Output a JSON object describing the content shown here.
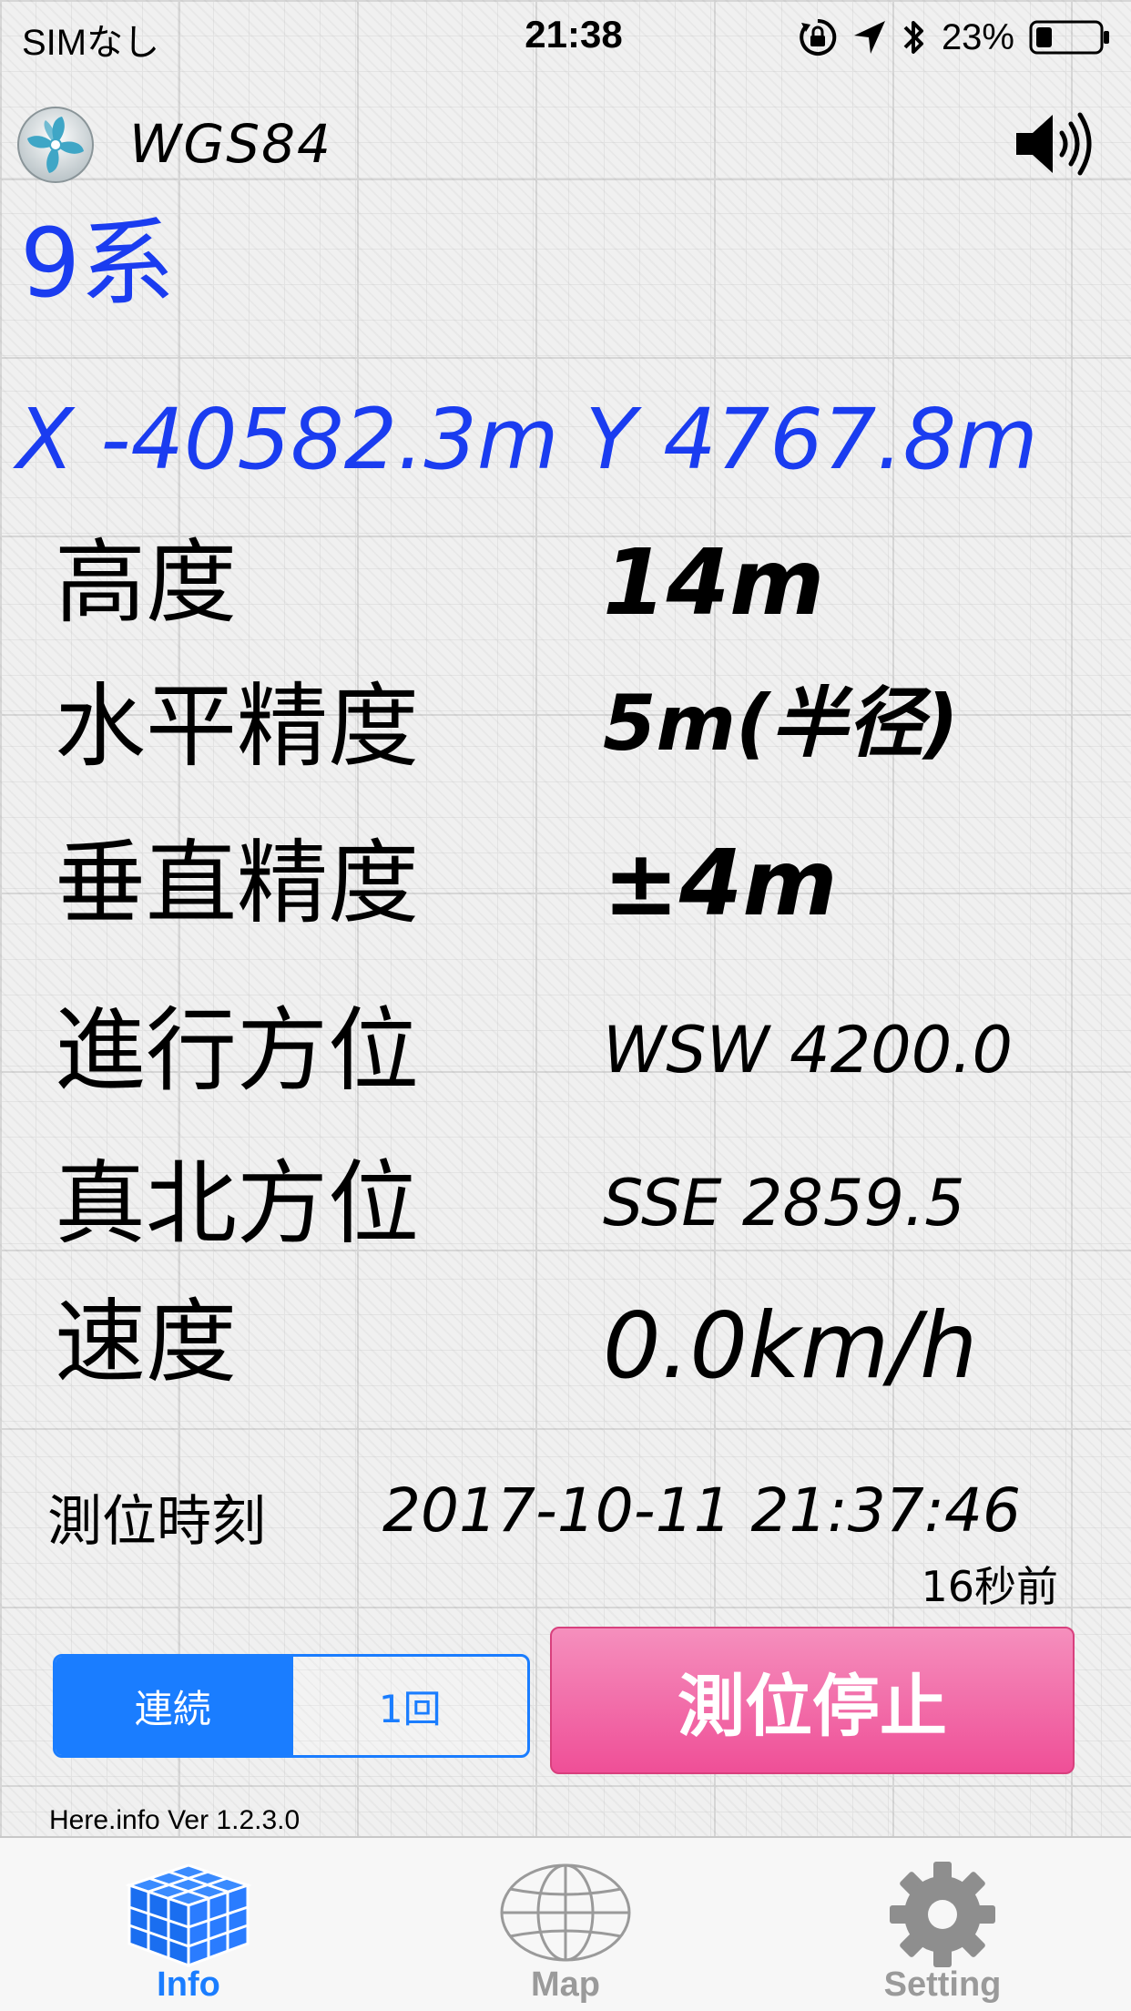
{
  "status_bar": {
    "carrier": "SIMなし",
    "time": "21:38",
    "battery": "23%",
    "icons": [
      "rotation-lock-icon",
      "location-arrow-icon",
      "bluetooth-icon",
      "battery-icon"
    ]
  },
  "header": {
    "logo_icon": "pinwheel-logo-icon",
    "datum": "WGS84",
    "sound_icon": "speaker-icon"
  },
  "zone": "9系",
  "coords": {
    "x": "X -40582.3m",
    "y": "Y 4767.8m"
  },
  "rows": [
    {
      "label": "高度",
      "value": "14m"
    },
    {
      "label": "水平精度",
      "value": "5m(半径)"
    },
    {
      "label": "垂直精度",
      "value": "±4m"
    },
    {
      "label": "進行方位",
      "value": "WSW 4200.0"
    },
    {
      "label": "真北方位",
      "value": "SSE 2859.5"
    },
    {
      "label": "速度",
      "value": "0.0km/h"
    }
  ],
  "fix": {
    "label": "測位時刻",
    "time": "2017-10-11  21:37:46",
    "ago": "16秒前"
  },
  "mode": {
    "continuous": "連続",
    "once": "1回",
    "selected": "continuous"
  },
  "stop_button": "測位停止",
  "version": "Here.info Ver 1.2.3.0",
  "tabs": [
    {
      "label": "Info",
      "icon": "cube-grid-icon",
      "active": true
    },
    {
      "label": "Map",
      "icon": "globe-icon",
      "active": false
    },
    {
      "label": "Setting",
      "icon": "gear-icon",
      "active": false
    }
  ],
  "colors": {
    "accent_blue": "#1a7dff",
    "coord_blue": "#1a3cf0",
    "stop_pink": "#ef4f97"
  }
}
